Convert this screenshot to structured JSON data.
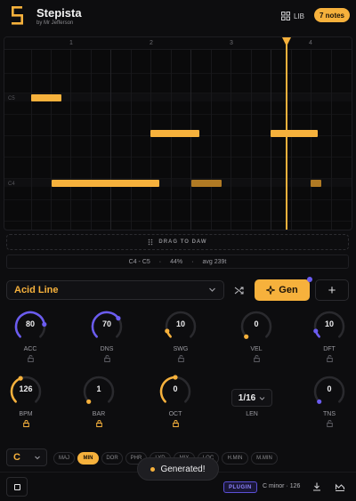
{
  "header": {
    "app_name": "Stepista",
    "author": "by Mr Jefferson",
    "lib_label": "LIB",
    "notes_badge": "7 notes",
    "logo_icon": "stepista-logo-icon",
    "lib_icon": "grid-icon"
  },
  "piano_roll": {
    "bars": [
      "1",
      "2",
      "3",
      "4"
    ],
    "key_labels": [
      "C5",
      "C4"
    ],
    "accent_color": "#f6b13c"
  },
  "drag_to_daw": {
    "label": "DRAG TO DAW",
    "icon": "drag-handle-icon"
  },
  "stats": {
    "range": "C4 - C5",
    "sep1": "·",
    "density": "44%",
    "sep2": "·",
    "avg": "avg 239t"
  },
  "controls": {
    "preset": "Acid Line",
    "preset_icon": "chevron-down-icon",
    "shuffle_icon": "shuffle-icon",
    "gen_label": "Gen",
    "gen_icon": "sparkle-icon",
    "add_label": "+"
  },
  "knobs_row1": [
    {
      "value": "80",
      "label": "ACC",
      "level": 0.8,
      "color": "#6b5cf0",
      "locked": false
    },
    {
      "value": "70",
      "label": "DNS",
      "level": 0.7,
      "color": "#6b5cf0",
      "locked": false
    },
    {
      "value": "10",
      "label": "SWG",
      "level": 0.1,
      "color": "#f6b13c",
      "locked": false
    },
    {
      "value": "0",
      "label": "VEL",
      "level": 0.0,
      "color": "#f6b13c",
      "locked": false
    },
    {
      "value": "10",
      "label": "DFT",
      "level": 0.1,
      "color": "#6b5cf0",
      "locked": false
    }
  ],
  "knobs_row2": [
    {
      "value": "126",
      "label": "BPM",
      "level": 0.42,
      "color": "#f6b13c",
      "locked": true
    },
    {
      "value": "1",
      "label": "BAR",
      "level": 0.0,
      "color": "#f6b13c",
      "locked": true
    },
    {
      "value": "0",
      "label": "OCT",
      "level": 0.5,
      "color": "#f6b13c",
      "locked": true
    },
    {
      "value": "0",
      "label": "TNS",
      "level": 0.0,
      "color": "#6b5cf0",
      "locked": false
    }
  ],
  "length": {
    "value": "1/16",
    "label": "LEN"
  },
  "scale_bar": {
    "key": "C",
    "scales": [
      "MAJ",
      "MIN",
      "DOR",
      "PHR",
      "LYD",
      "MIX",
      "LOC",
      "H.MIN",
      "M.MIN"
    ],
    "active": "MIN"
  },
  "toast": {
    "message": "Generated!"
  },
  "footer": {
    "plugin_label": "PLUGIN",
    "key_info": "C minor · 126",
    "download_icon": "download-icon",
    "midi_icon": "midi-icon",
    "stop_icon": "stop-icon"
  }
}
